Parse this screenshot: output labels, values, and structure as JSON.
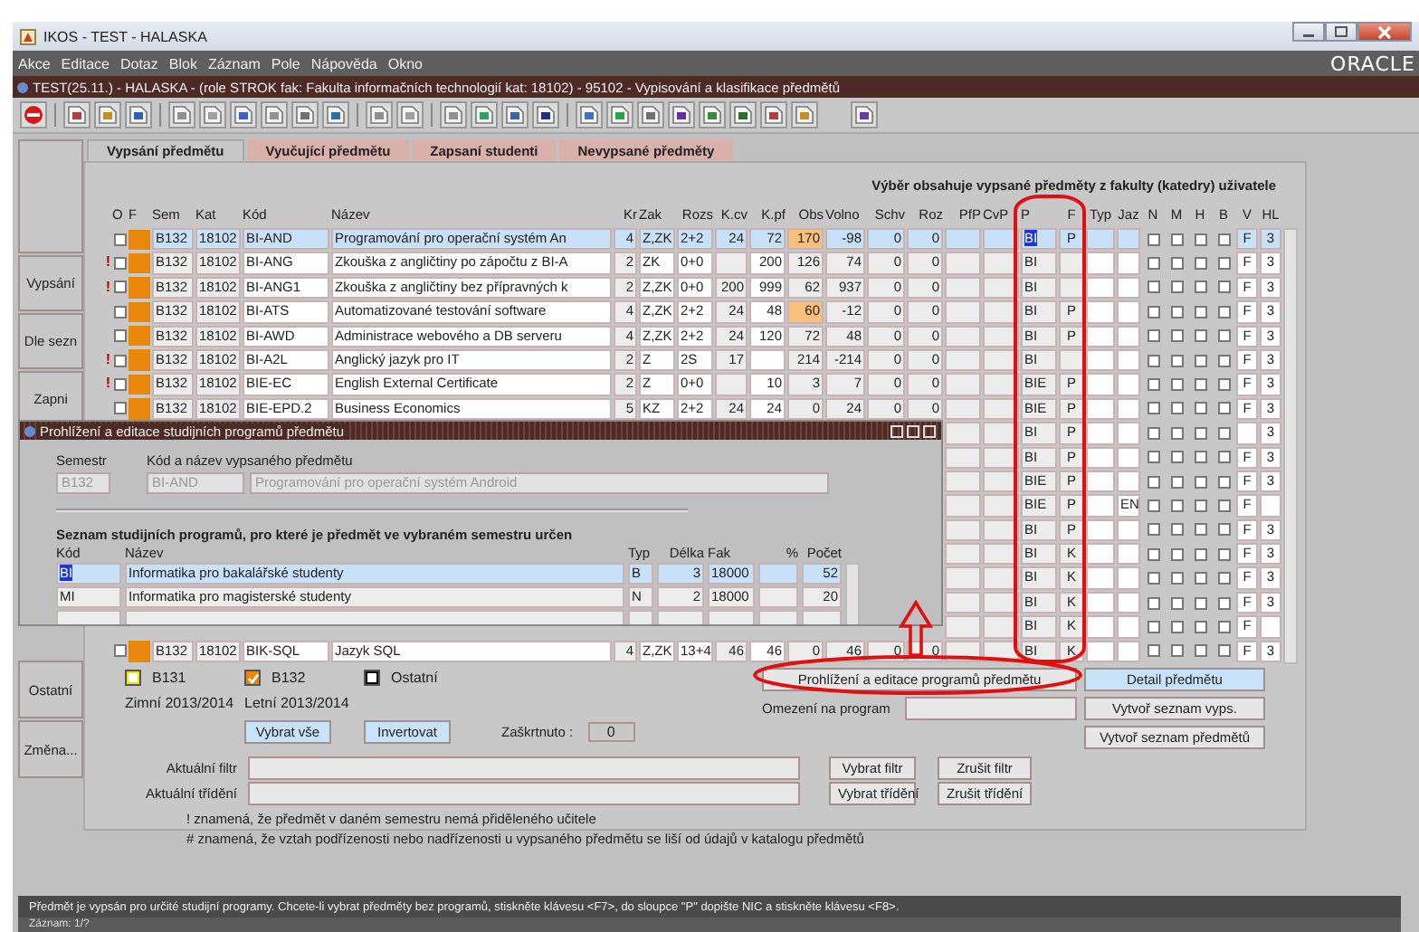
{
  "window": {
    "title": "IKOS - TEST - HALASKA"
  },
  "menu": [
    "Akce",
    "Editace",
    "Dotaz",
    "Blok",
    "Záznam",
    "Pole",
    "Nápověda",
    "Okno"
  ],
  "brand": "ORACLE",
  "form_title": "TEST(25.11.) - HALASKA - (role STROK fak: Fakulta informačních technologií kat: 18102) - 95102 - Vypisování a klasifikace předmětů",
  "tabs": [
    {
      "label": "Vypsání předmětu",
      "selected": true
    },
    {
      "label": "Vyučující předmětu",
      "selected": false
    },
    {
      "label": "Zapsaní studenti",
      "selected": false
    },
    {
      "label": "Nevypsané předměty",
      "selected": false
    }
  ],
  "sidebar": {
    "top_items": [
      "Vypsání",
      "Dle sezn",
      "Zapni"
    ],
    "bottom_items": [
      "Ostatní",
      "Změna..."
    ]
  },
  "table": {
    "caption": "Výběr obsahuje vypsané předměty z fakulty (katedry) uživatele",
    "columns": [
      "O",
      "F",
      "Sem",
      "Kat",
      "Kód",
      "Název",
      "Kr",
      "Zak",
      "Rozs",
      "K.cv",
      "K.pf",
      "Obs",
      "Volno",
      "Schv",
      "Roz",
      "PfP",
      "CvP",
      "P",
      "F",
      "Typ",
      "Jaz",
      "N",
      "M",
      "H",
      "B",
      "V",
      "HL"
    ],
    "rows": [
      {
        "selected": true,
        "o": false,
        "sem": "B132",
        "kat": "18102",
        "kod": "BI-AND",
        "nazev": "Programování pro operační systém An",
        "kr": "4",
        "zak": "Z,ZK",
        "rozs": "2+2",
        "kcv": "24",
        "kpf": "72",
        "obs": "170",
        "obs_warn": true,
        "volno": "-98",
        "schv": "0",
        "roz": "0",
        "p": "BI",
        "f": "P",
        "flags": [
          false,
          false,
          false,
          false
        ],
        "v": "F",
        "hl": "3"
      },
      {
        "selected": false,
        "mark": "!",
        "o": false,
        "sem": "B132",
        "kat": "18102",
        "kod": "BI-ANG",
        "nazev": "Zkouška z angličtiny po zápočtu z BI-A",
        "kr": "2",
        "zak": "ZK",
        "rozs": "0+0",
        "kpf": "200",
        "obs": "126",
        "obs_warn": false,
        "volno": "74",
        "schv": "0",
        "roz": "0",
        "p": "BI",
        "flags": [
          false,
          false,
          false,
          false
        ],
        "v": "F",
        "hl": "3"
      },
      {
        "selected": false,
        "mark": "!",
        "o": false,
        "sem": "B132",
        "kat": "18102",
        "kod": "BI-ANG1",
        "nazev": "Zkouška z angličtiny bez přípravných k",
        "kr": "2",
        "zak": "Z,ZK",
        "rozs": "0+0",
        "kcv": "200",
        "kpf": "999",
        "obs": "62",
        "obs_warn": false,
        "volno": "937",
        "schv": "0",
        "roz": "0",
        "p": "BI",
        "flags": [
          false,
          false,
          false,
          false
        ],
        "v": "F",
        "hl": "3"
      },
      {
        "selected": false,
        "o": false,
        "sem": "B132",
        "kat": "18102",
        "kod": "BI-ATS",
        "nazev": "Automatizované testování software",
        "kr": "4",
        "zak": "Z,ZK",
        "rozs": "2+2",
        "kcv": "24",
        "kpf": "48",
        "obs": "60",
        "obs_warn": true,
        "volno": "-12",
        "schv": "0",
        "roz": "0",
        "p": "BI",
        "f": "P",
        "flags": [
          false,
          false,
          false,
          false
        ],
        "v": "F",
        "hl": "3"
      },
      {
        "selected": false,
        "o": false,
        "sem": "B132",
        "kat": "18102",
        "kod": "BI-AWD",
        "nazev": "Administrace webového a DB serveru",
        "kr": "4",
        "zak": "Z,ZK",
        "rozs": "2+2",
        "kcv": "24",
        "kpf": "120",
        "obs": "72",
        "obs_warn": false,
        "volno": "48",
        "schv": "0",
        "roz": "0",
        "p": "BI",
        "f": "P",
        "flags": [
          false,
          false,
          false,
          false
        ],
        "v": "F",
        "hl": "3"
      },
      {
        "selected": false,
        "mark": "!",
        "o": false,
        "sem": "B132",
        "kat": "18102",
        "kod": "BI-A2L",
        "nazev": "Anglický jazyk pro IT",
        "kr": "2",
        "zak": "Z",
        "rozs": "2S",
        "kcv": "17",
        "obs": "214",
        "obs_warn": false,
        "volno": "-214",
        "schv": "0",
        "roz": "0",
        "p": "BI",
        "flags": [
          false,
          false,
          false,
          false
        ],
        "v": "F",
        "hl": "3"
      },
      {
        "selected": false,
        "mark": "!",
        "o": false,
        "sem": "B132",
        "kat": "18102",
        "kod": "BIE-EC",
        "nazev": "English External Certificate",
        "kr": "2",
        "zak": "Z",
        "rozs": "0+0",
        "kpf": "10",
        "obs": "3",
        "obs_warn": false,
        "volno": "7",
        "schv": "0",
        "roz": "0",
        "p": "BIE",
        "f": "P",
        "flags": [
          false,
          false,
          false,
          false
        ],
        "v": "F",
        "hl": "3"
      },
      {
        "selected": false,
        "o": false,
        "sem": "B132",
        "kat": "18102",
        "kod": "BIE-EPD.2",
        "nazev": "Business Economics",
        "kr": "5",
        "zak": "KZ",
        "rozs": "2+2",
        "kcv": "24",
        "kpf": "24",
        "obs": "0",
        "obs_warn": false,
        "volno": "24",
        "schv": "0",
        "roz": "0",
        "p": "BIE",
        "f": "P",
        "flags": [
          false,
          false,
          false,
          false
        ],
        "v": "F",
        "hl": "3"
      },
      {
        "selected": false,
        "p": "BI",
        "f": "P",
        "flags": [
          false,
          false,
          false,
          false
        ],
        "hl": "3"
      },
      {
        "selected": false,
        "p": "BI",
        "f": "P",
        "flags": [
          false,
          false,
          false,
          false
        ],
        "v": "F",
        "hl": "3"
      },
      {
        "selected": false,
        "p": "BIE",
        "f": "P",
        "flags": [
          false,
          false,
          false,
          false
        ],
        "v": "F",
        "hl": "3"
      },
      {
        "selected": false,
        "p": "BIE",
        "f": "P",
        "jaz": "EN",
        "flags": [
          false,
          false,
          false,
          false
        ],
        "v": "F"
      },
      {
        "selected": false,
        "p": "BI",
        "f": "P",
        "flags": [
          false,
          false,
          false,
          false
        ],
        "v": "F",
        "hl": "3"
      },
      {
        "selected": false,
        "p": "BI",
        "f": "K",
        "flags": [
          false,
          false,
          false,
          false
        ],
        "v": "F",
        "hl": "3"
      },
      {
        "selected": false,
        "p": "BI",
        "f": "K",
        "flags": [
          false,
          false,
          false,
          false
        ],
        "v": "F",
        "hl": "3"
      },
      {
        "selected": false,
        "p": "BI",
        "f": "K",
        "flags": [
          false,
          false,
          false,
          false
        ],
        "v": "F",
        "hl": "3"
      },
      {
        "selected": false,
        "p": "BI",
        "f": "K",
        "flags": [
          false,
          false,
          false,
          false
        ],
        "v": "F"
      },
      {
        "selected": false,
        "o": false,
        "sem": "B132",
        "kat": "18102",
        "kod": "BIK-SQL",
        "nazev": "Jazyk SQL",
        "kr": "4",
        "zak": "Z,ZK",
        "rozs": "13+4",
        "kcv": "46",
        "kpf": "46",
        "obs": "0",
        "obs_warn": false,
        "volno": "46",
        "schv": "0",
        "roz": "0",
        "p": "BI",
        "f": "K",
        "flags": [
          false,
          false,
          false,
          false
        ],
        "v": "F",
        "hl": "3"
      }
    ]
  },
  "dialog": {
    "title": "Prohlížení a editace studijních programů předmětu",
    "semestr_label": "Semestr",
    "semestr": "B132",
    "course_label": "Kód a název vypsaného předmětu",
    "course_code": "BI-AND",
    "course_name": "Programování pro operační systém Android",
    "list_heading": "Seznam studijních programů, pro které je předmět ve vybraném semestru určen",
    "columns": [
      "Kód",
      "Název",
      "Typ",
      "Délka",
      "Fak",
      "%",
      "Počet"
    ],
    "rows": [
      {
        "selected": true,
        "kod": "BI",
        "nazev": "Informatika pro bakalářské studenty",
        "typ": "B",
        "delka": "3",
        "fak": "18000",
        "pocet": "52"
      },
      {
        "selected": false,
        "kod": "MI",
        "nazev": "Informatika pro magisterské studenty",
        "typ": "N",
        "delka": "2",
        "fak": "18000",
        "pocet": "20"
      }
    ]
  },
  "legend": [
    {
      "label": "B131",
      "season": "Zimní 2013/2014",
      "color": "#f2e600",
      "checked": false
    },
    {
      "label": "B132",
      "season": "Letní 2013/2014",
      "color": "#e8870a",
      "checked": true
    },
    {
      "label": "Ostatní",
      "color": "#000000",
      "checked": false
    }
  ],
  "select_buttons": [
    "Vybrat vše",
    "Invertovat"
  ],
  "checked_count": {
    "label": "Zaškrtnuto :",
    "value": "0"
  },
  "program_button": "Prohlížení a editace programů předmětu",
  "detail_button": "Detail předmětu",
  "program_filter": {
    "label": "Omezení na program"
  },
  "list_buttons": [
    "Vytvoř seznam vyps.",
    "Vytvoř seznam předmětů"
  ],
  "filter": {
    "label": "Aktuální filtr"
  },
  "sort": {
    "label": "Aktuální třídění"
  },
  "filter_buttons": [
    "Vybrat filtr",
    "Zrušit filtr",
    "Vybrat třídění",
    "Zrušit třídění"
  ],
  "notes": [
    "! znamená, že předmět v daném semestru nemá přiděleného učitele",
    "# znamená, že vztah podřízenosti nebo nadřízenosti u vypsaného předmětu se liší od údajů v katalogu předmětů"
  ],
  "status_bar": {
    "message": "Předmět je vypsán pro určité studijní programy. Chcete-li vybrat předměty bez programů, stiskněte klávesu <F7>, do sloupce \"P\" dopište NIC a stiskněte klávesu <F8>.",
    "record": "Záznam: 1/?"
  }
}
